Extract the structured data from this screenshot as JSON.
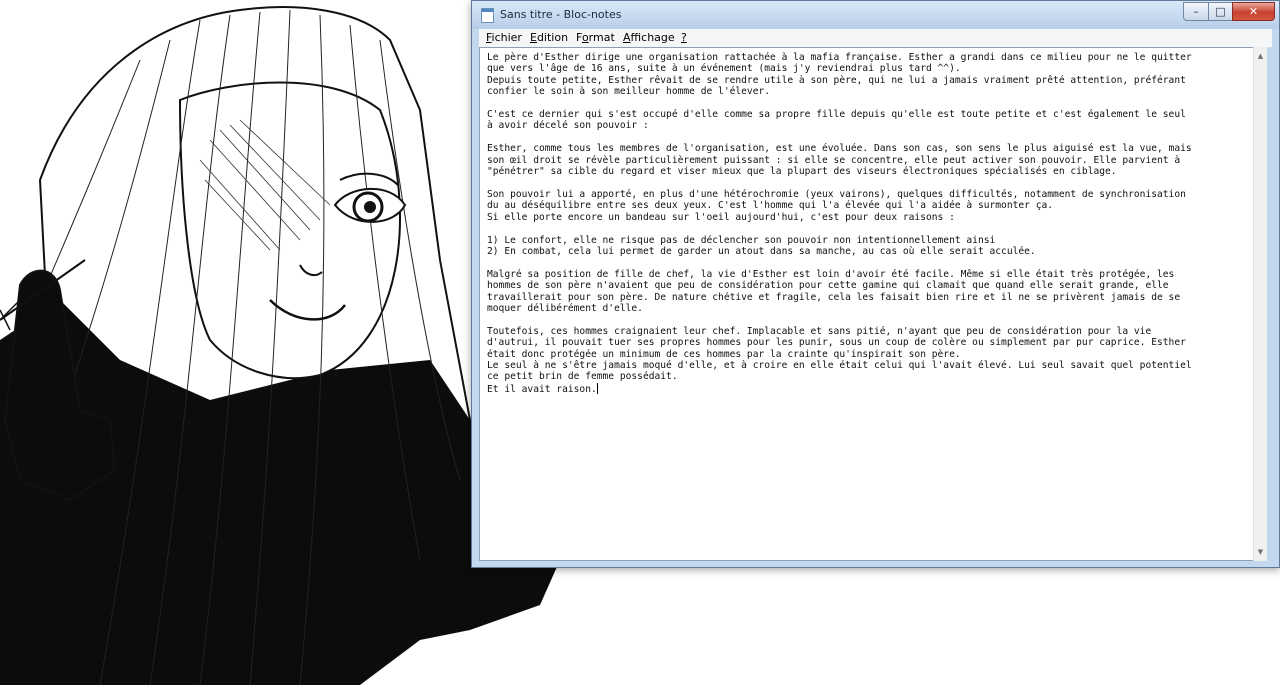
{
  "window": {
    "title": "Sans titre - Bloc-notes",
    "icons": {
      "app": "notepad-icon",
      "minimize": "minimize-icon",
      "maximize": "maximize-icon",
      "close": "close-icon"
    },
    "captions": {
      "minimize": "–",
      "maximize": "□",
      "close": "✕"
    }
  },
  "menu": {
    "fichier": {
      "key": "F",
      "rest": "ichier"
    },
    "edition": {
      "key": "E",
      "rest": "dition"
    },
    "format": {
      "pre": "F",
      "key": "o",
      "rest": "rmat"
    },
    "affichage": {
      "key": "A",
      "rest": "ffichage"
    },
    "help": {
      "key": "?"
    }
  },
  "document": {
    "lines": [
      "Le père d'Esther dirige une organisation rattachée à la mafia française. Esther a grandi dans ce milieu pour ne le quitter",
      "que vers l'âge de 16 ans, suite à un événement (mais j'y reviendrai plus tard ^^).",
      "Depuis toute petite, Esther rêvait de se rendre utile à son père, qui ne lui a jamais vraiment prêté attention, préférant",
      "confier le soin à son meilleur homme de l'élever.",
      "",
      "C'est ce dernier qui s'est occupé d'elle comme sa propre fille depuis qu'elle est toute petite et c'est également le seul",
      "à avoir décelé son pouvoir :",
      "",
      "Esther, comme tous les membres de l'organisation, est une évoluée. Dans son cas, son sens le plus aiguisé est la vue, mais",
      "son œil droit se révèle particulièrement puissant : si elle se concentre, elle peut activer son pouvoir. Elle parvient à",
      "\"pénétrer\" sa cible du regard et viser mieux que la plupart des viseurs électroniques spécialisés en ciblage.",
      "",
      "Son pouvoir lui a apporté, en plus d'une hétérochromie (yeux vairons), quelques difficultés, notamment de synchronisation",
      "du au déséquilibre entre ses deux yeux. C'est l'homme qui l'a élevée qui l'a aidée à surmonter ça.",
      "Si elle porte encore un bandeau sur l'oeil aujourd'hui, c'est pour deux raisons :",
      "",
      "1) Le confort, elle ne risque pas de déclencher son pouvoir non intentionnellement ainsi",
      "2) En combat, cela lui permet de garder un atout dans sa manche, au cas où elle serait acculée.",
      "",
      "Malgré sa position de fille de chef, la vie d'Esther est loin d'avoir été facile. Même si elle était très protégée, les",
      "hommes de son père n'avaient que peu de considération pour cette gamine qui clamait que quand elle serait grande, elle",
      "travaillerait pour son père. De nature chétive et fragile, cela les faisait bien rire et il ne se privèrent jamais de se",
      "moquer délibérément d'elle.",
      "",
      "Toutefois, ces hommes craignaient leur chef. Implacable et sans pitié, n'ayant que peu de considération pour la vie",
      "d'autrui, il pouvait tuer ses propres hommes pour les punir, sous un coup de colère ou simplement par pur caprice. Esther",
      "était donc protégée un minimum de ces hommes par la crainte qu'inspirait son père.",
      "Le seul à ne s'être jamais moqué d'elle, et à croire en elle était celui qui l'avait élevé. Lui seul savait quel potentiel",
      "ce petit brin de femme possédait.",
      "Et il avait raison."
    ]
  },
  "scrollbar": {
    "up_icon": "scroll-up-arrow-icon",
    "down_icon": "scroll-down-arrow-icon",
    "up": "▲",
    "down": "▼"
  }
}
